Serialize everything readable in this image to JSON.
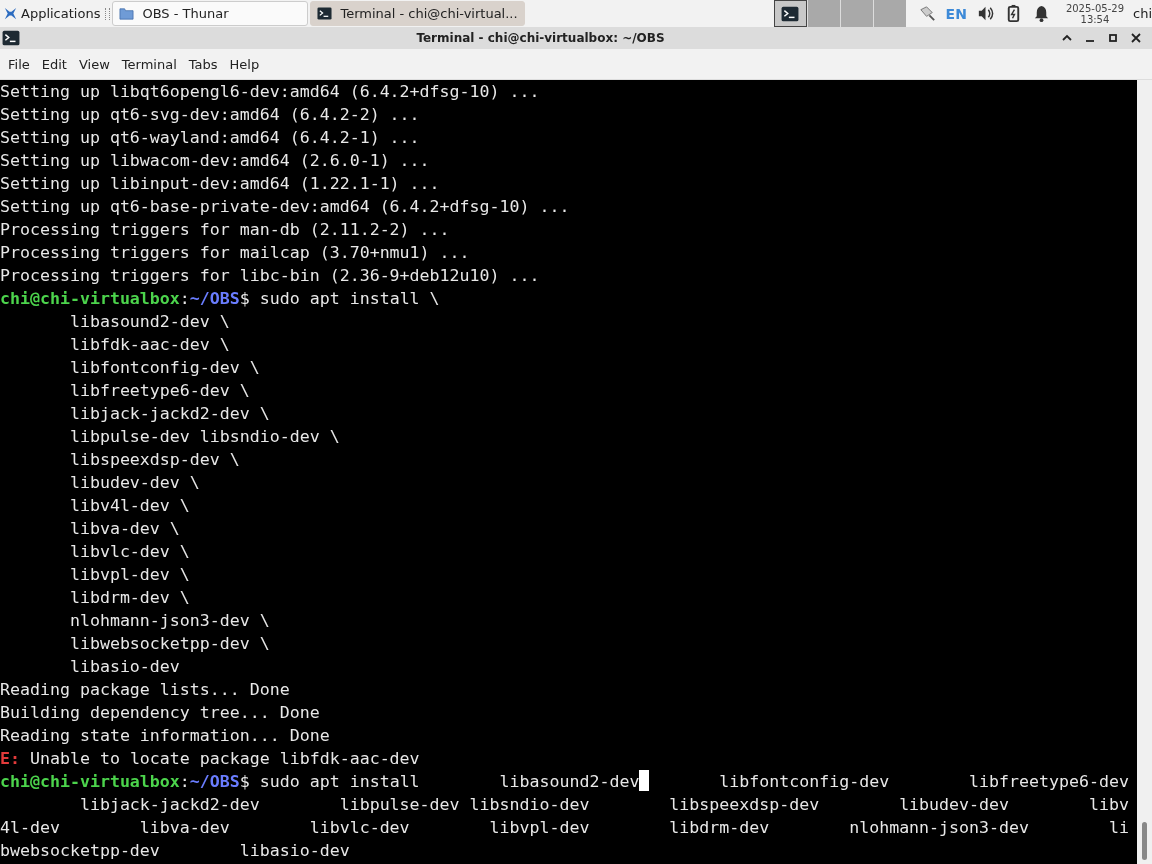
{
  "panel": {
    "app_menu": "Applications",
    "tasks": [
      {
        "label": "OBS - Thunar",
        "kind": "folder",
        "selected": false
      },
      {
        "label": "Terminal - chi@chi-virtual...",
        "kind": "terminal",
        "selected": true
      }
    ],
    "workspaces": [
      {
        "selected": true
      },
      {
        "selected": false
      },
      {
        "selected": false
      },
      {
        "selected": false
      }
    ],
    "language": "EN",
    "date": "2025-05-29",
    "time": "13:54",
    "user": "chi"
  },
  "window": {
    "title": "Terminal - chi@chi-virtualbox: ~/OBS",
    "menu": [
      "File",
      "Edit",
      "View",
      "Terminal",
      "Tabs",
      "Help"
    ]
  },
  "terminal": {
    "lines": [
      {
        "segments": [
          {
            "kind": "plain",
            "text": "Setting up libqt6opengl6-dev:amd64 (6.4.2+dfsg-10) ..."
          }
        ]
      },
      {
        "segments": [
          {
            "kind": "plain",
            "text": "Setting up qt6-svg-dev:amd64 (6.4.2-2) ..."
          }
        ]
      },
      {
        "segments": [
          {
            "kind": "plain",
            "text": "Setting up qt6-wayland:amd64 (6.4.2-1) ..."
          }
        ]
      },
      {
        "segments": [
          {
            "kind": "plain",
            "text": "Setting up libwacom-dev:amd64 (2.6.0-1) ..."
          }
        ]
      },
      {
        "segments": [
          {
            "kind": "plain",
            "text": "Setting up libinput-dev:amd64 (1.22.1-1) ..."
          }
        ]
      },
      {
        "segments": [
          {
            "kind": "plain",
            "text": "Setting up qt6-base-private-dev:amd64 (6.4.2+dfsg-10) ..."
          }
        ]
      },
      {
        "segments": [
          {
            "kind": "plain",
            "text": "Processing triggers for man-db (2.11.2-2) ..."
          }
        ]
      },
      {
        "segments": [
          {
            "kind": "plain",
            "text": "Processing triggers for mailcap (3.70+nmu1) ..."
          }
        ]
      },
      {
        "segments": [
          {
            "kind": "plain",
            "text": "Processing triggers for libc-bin (2.36-9+deb12u10) ..."
          }
        ]
      },
      {
        "segments": [
          {
            "kind": "user",
            "text": "chi@chi-virtualbox"
          },
          {
            "kind": "plain",
            "text": ":"
          },
          {
            "kind": "path",
            "text": "~/OBS"
          },
          {
            "kind": "plain",
            "text": "$ sudo apt install \\"
          }
        ]
      },
      {
        "segments": [
          {
            "kind": "plain",
            "text": "       libasound2-dev \\"
          }
        ]
      },
      {
        "segments": [
          {
            "kind": "plain",
            "text": "       libfdk-aac-dev \\"
          }
        ]
      },
      {
        "segments": [
          {
            "kind": "plain",
            "text": "       libfontconfig-dev \\"
          }
        ]
      },
      {
        "segments": [
          {
            "kind": "plain",
            "text": "       libfreetype6-dev \\"
          }
        ]
      },
      {
        "segments": [
          {
            "kind": "plain",
            "text": "       libjack-jackd2-dev \\"
          }
        ]
      },
      {
        "segments": [
          {
            "kind": "plain",
            "text": "       libpulse-dev libsndio-dev \\"
          }
        ]
      },
      {
        "segments": [
          {
            "kind": "plain",
            "text": "       libspeexdsp-dev \\"
          }
        ]
      },
      {
        "segments": [
          {
            "kind": "plain",
            "text": "       libudev-dev \\"
          }
        ]
      },
      {
        "segments": [
          {
            "kind": "plain",
            "text": "       libv4l-dev \\"
          }
        ]
      },
      {
        "segments": [
          {
            "kind": "plain",
            "text": "       libva-dev \\"
          }
        ]
      },
      {
        "segments": [
          {
            "kind": "plain",
            "text": "       libvlc-dev \\"
          }
        ]
      },
      {
        "segments": [
          {
            "kind": "plain",
            "text": "       libvpl-dev \\"
          }
        ]
      },
      {
        "segments": [
          {
            "kind": "plain",
            "text": "       libdrm-dev \\"
          }
        ]
      },
      {
        "segments": [
          {
            "kind": "plain",
            "text": "       nlohmann-json3-dev \\"
          }
        ]
      },
      {
        "segments": [
          {
            "kind": "plain",
            "text": "       libwebsocketpp-dev \\"
          }
        ]
      },
      {
        "segments": [
          {
            "kind": "plain",
            "text": "       libasio-dev"
          }
        ]
      },
      {
        "segments": [
          {
            "kind": "plain",
            "text": "Reading package lists... Done"
          }
        ]
      },
      {
        "segments": [
          {
            "kind": "plain",
            "text": "Building dependency tree... Done"
          }
        ]
      },
      {
        "segments": [
          {
            "kind": "plain",
            "text": "Reading state information... Done"
          }
        ]
      },
      {
        "segments": [
          {
            "kind": "error",
            "text": "E:"
          },
          {
            "kind": "plain",
            "text": " Unable to locate package libfdk-aac-dev"
          }
        ]
      },
      {
        "segments": [
          {
            "kind": "user",
            "text": "chi@chi-virtualbox"
          },
          {
            "kind": "plain",
            "text": ":"
          },
          {
            "kind": "path",
            "text": "~/OBS"
          },
          {
            "kind": "plain",
            "text": "$ sudo apt install        libasound2-dev"
          },
          {
            "kind": "cursor"
          },
          {
            "kind": "plain",
            "text": "       libfontconfig-dev        libfreetype6-dev"
          }
        ]
      },
      {
        "segments": [
          {
            "kind": "plain",
            "text": "        libjack-jackd2-dev        libpulse-dev libsndio-dev        libspeexdsp-dev        libudev-dev        libv"
          }
        ]
      },
      {
        "segments": [
          {
            "kind": "plain",
            "text": "4l-dev        libva-dev        libvlc-dev        libvpl-dev        libdrm-dev        nlohmann-json3-dev        li"
          }
        ]
      },
      {
        "segments": [
          {
            "kind": "plain",
            "text": "bwebsocketpp-dev        libasio-dev"
          }
        ]
      }
    ]
  }
}
